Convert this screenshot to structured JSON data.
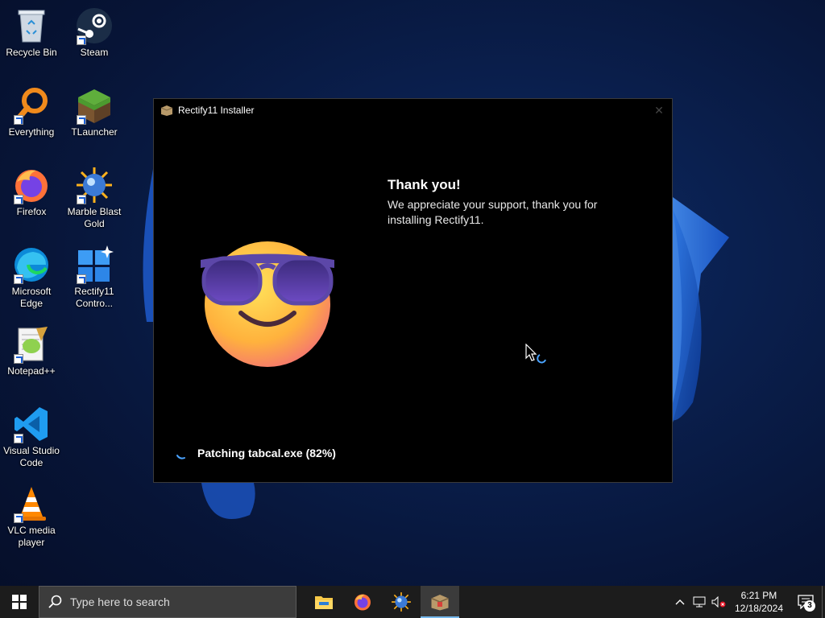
{
  "desktop": {
    "icons": [
      {
        "label": "Recycle Bin",
        "icon": "recycle-bin-icon"
      },
      {
        "label": "Steam",
        "icon": "steam-icon"
      },
      {
        "label": "Everything",
        "icon": "everything-search-icon"
      },
      {
        "label": "TLauncher",
        "icon": "tlauncher-grass-block-icon"
      },
      {
        "label": "Firefox",
        "icon": "firefox-icon"
      },
      {
        "label": "Marble Blast Gold",
        "icon": "marble-blast-icon"
      },
      {
        "label": "Microsoft Edge",
        "icon": "edge-icon"
      },
      {
        "label": "Rectify11 Contro...",
        "icon": "rectify11-control-panel-icon"
      },
      {
        "label": "Notepad++",
        "icon": "notepad-plus-plus-icon"
      },
      {
        "label": "Visual Studio Code",
        "icon": "vscode-icon"
      },
      {
        "label": "VLC media player",
        "icon": "vlc-icon"
      }
    ]
  },
  "installer": {
    "title": "Rectify11 Installer",
    "close_glyph": "✕",
    "heading": "Thank you!",
    "message": "We appreciate your support, thank you for installing Rectify11.",
    "status": "Patching tabcal.exe (82%)",
    "progress_percent": 82
  },
  "taskbar": {
    "search_placeholder": "Type here to search",
    "pinned": [
      "file-explorer-icon",
      "firefox-icon",
      "marble-blast-icon",
      "rectify11-installer-icon"
    ],
    "time": "6:21 PM",
    "date": "12/18/2024",
    "notification_count": "3"
  },
  "colors": {
    "accent": "#76b9ed",
    "window_bg": "#000000",
    "taskbar_bg": "#1c1c1c"
  }
}
